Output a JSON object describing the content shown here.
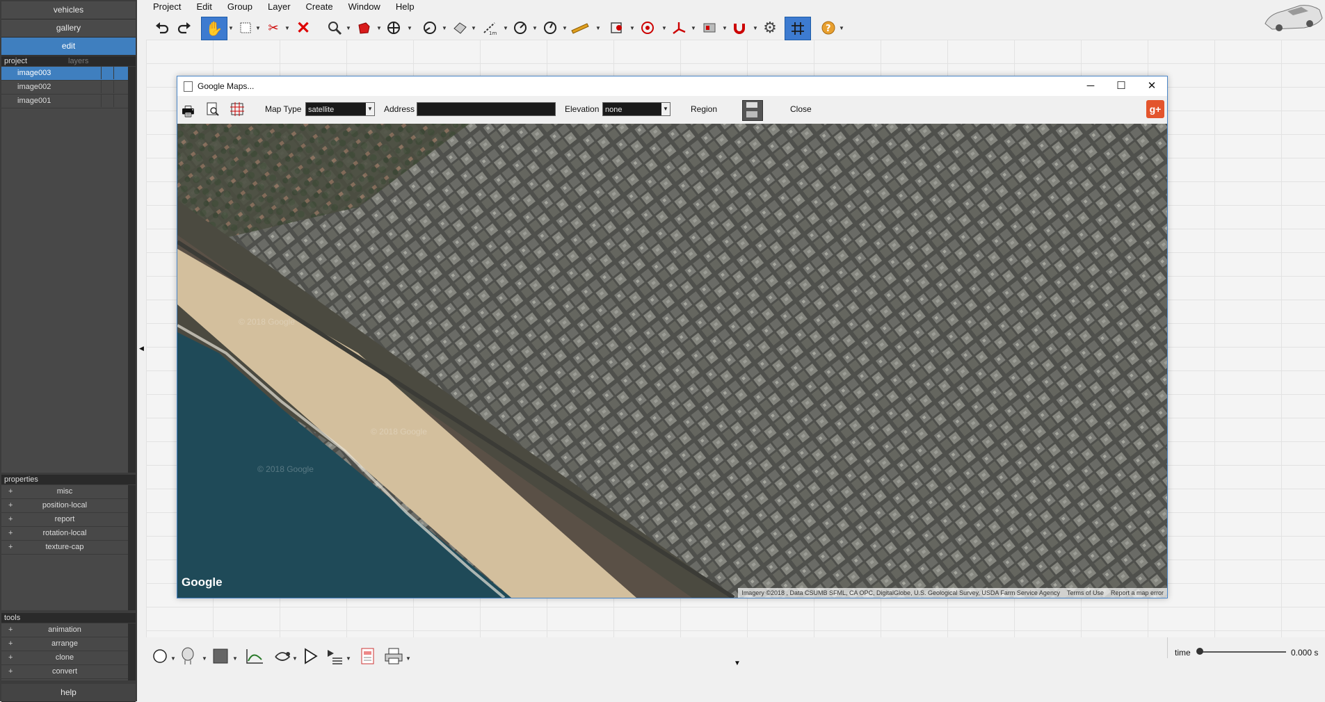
{
  "left_panel": {
    "vehicles_label": "vehicles",
    "gallery_label": "gallery",
    "edit_label": "edit",
    "project_tab": "project",
    "layers_tab": "layers",
    "images": [
      "image003",
      "image002",
      "image001"
    ],
    "properties_header": "properties",
    "properties": [
      "misc",
      "position-local",
      "report",
      "rotation-local",
      "texture-cap"
    ],
    "tools_header": "tools",
    "tools": [
      "animation",
      "arrange",
      "clone",
      "convert"
    ],
    "help_label": "help",
    "collapse_glyph": "◀"
  },
  "menubar": [
    "Project",
    "Edit",
    "Group",
    "Layer",
    "Create",
    "Window",
    "Help"
  ],
  "map_window": {
    "title": "Google Maps...",
    "map_type_label": "Map Type",
    "map_type_value": "satellite",
    "address_label": "Address",
    "address_value": "",
    "elevation_label": "Elevation",
    "elevation_value": "none",
    "region_label": "Region",
    "close_label": "Close",
    "google_logo": "Google",
    "watermark": "© 2018 Google",
    "attribution": "Imagery ©2018 , Data CSUMB SFML, CA OPC, DigitalGlobe, U.S. Geological Survey, USDA Farm Service Agency",
    "terms_label": "Terms of Use",
    "report_label": "Report a map error",
    "gplus_label": "g+"
  },
  "status": {
    "time_label": "time",
    "time_value": "0.000 s",
    "time_fraction": 0
  },
  "colors": {
    "accent": "#3f7fbf",
    "panel_bg": "#3c3c3c",
    "water": "#1f4a58",
    "sand": "#d6c2a0",
    "city": "#62635e"
  }
}
